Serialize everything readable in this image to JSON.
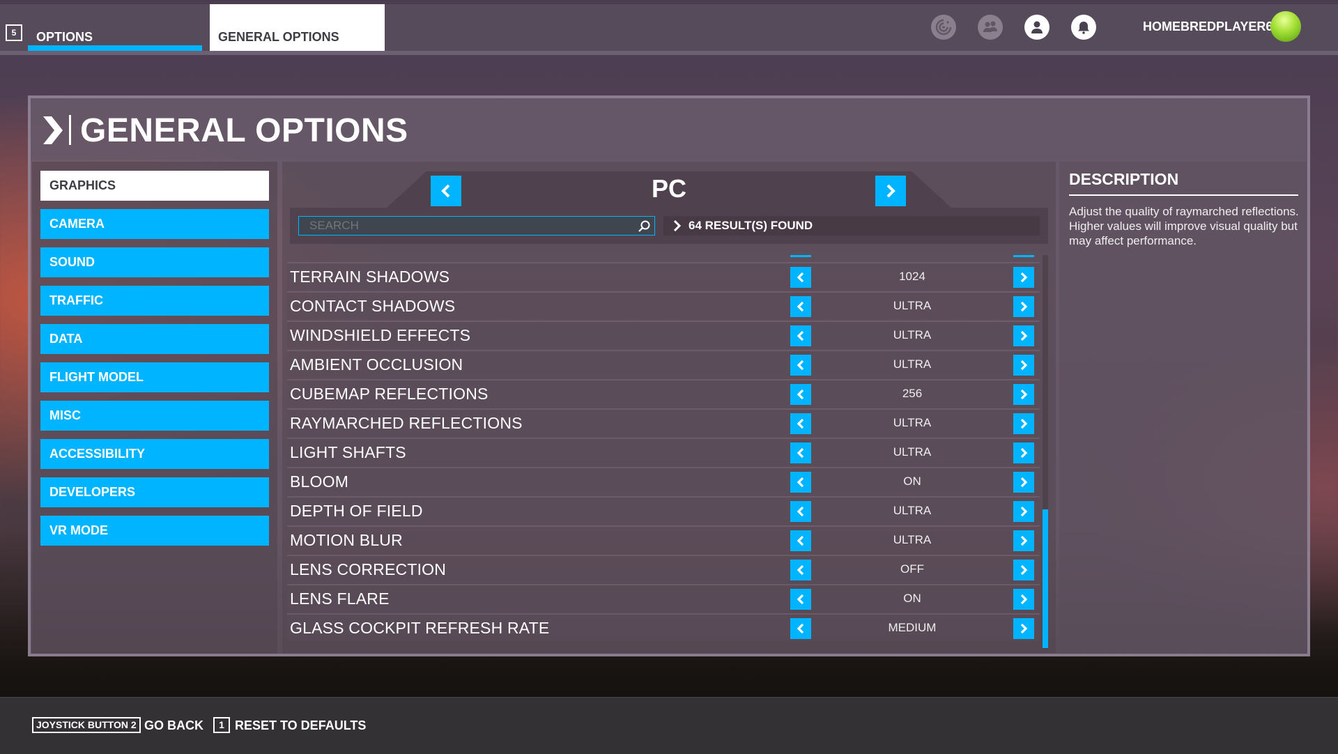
{
  "topbar": {
    "key_hint": "5",
    "tabs": [
      {
        "label": "OPTIONS",
        "state": "underlined"
      },
      {
        "label": "GENERAL OPTIONS",
        "state": "active"
      }
    ],
    "icons": [
      "activity-radar-icon",
      "friends-icon",
      "profile-icon",
      "notifications-bell-icon"
    ],
    "username": "HOMEBREDPLAYER6"
  },
  "page": {
    "title": "GENERAL OPTIONS"
  },
  "sidebar": {
    "items": [
      {
        "label": "GRAPHICS",
        "active": true
      },
      {
        "label": "CAMERA",
        "active": false
      },
      {
        "label": "SOUND",
        "active": false
      },
      {
        "label": "TRAFFIC",
        "active": false
      },
      {
        "label": "DATA",
        "active": false
      },
      {
        "label": "FLIGHT MODEL",
        "active": false
      },
      {
        "label": "MISC",
        "active": false
      },
      {
        "label": "ACCESSIBILITY",
        "active": false
      },
      {
        "label": "DEVELOPERS",
        "active": false
      },
      {
        "label": "VR MODE",
        "active": false
      }
    ]
  },
  "settings_header": {
    "preset": "PC",
    "search_placeholder": "SEARCH",
    "search_value": "",
    "results_text": "64 RESULT(S) FOUND"
  },
  "settings": [
    {
      "label": "TERRAIN SHADOWS",
      "value": "1024"
    },
    {
      "label": "CONTACT SHADOWS",
      "value": "ULTRA"
    },
    {
      "label": "WINDSHIELD EFFECTS",
      "value": "ULTRA"
    },
    {
      "label": "AMBIENT OCCLUSION",
      "value": "ULTRA"
    },
    {
      "label": "CUBEMAP REFLECTIONS",
      "value": "256"
    },
    {
      "label": "RAYMARCHED REFLECTIONS",
      "value": "ULTRA"
    },
    {
      "label": "LIGHT SHAFTS",
      "value": "ULTRA"
    },
    {
      "label": "BLOOM",
      "value": "ON"
    },
    {
      "label": "DEPTH OF FIELD",
      "value": "ULTRA"
    },
    {
      "label": "MOTION BLUR",
      "value": "ULTRA"
    },
    {
      "label": "LENS CORRECTION",
      "value": "OFF"
    },
    {
      "label": "LENS FLARE",
      "value": "ON"
    },
    {
      "label": "GLASS COCKPIT REFRESH RATE",
      "value": "MEDIUM"
    }
  ],
  "scroll": {
    "position_fraction": 1.0
  },
  "description": {
    "title": "DESCRIPTION",
    "body": "Adjust the quality of raymarched reflections.\nHigher values will improve visual quality but may affect performance."
  },
  "footer": {
    "back_key": "JOYSTICK BUTTON 2",
    "back_label": "GO BACK",
    "reset_key": "1",
    "reset_label": "RESET TO DEFAULTS"
  },
  "colors": {
    "accent": "#00b4ff",
    "active_tab_bg": "#ffffff",
    "text": "#ffffff"
  }
}
